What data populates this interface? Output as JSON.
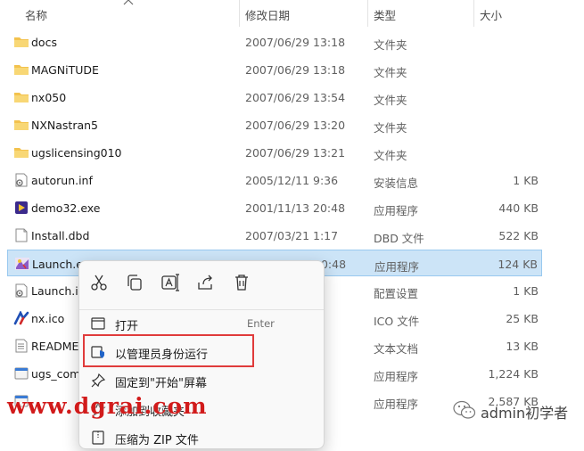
{
  "header": {
    "name": "名称",
    "date": "修改日期",
    "type": "类型",
    "size": "大小"
  },
  "files": [
    {
      "name": "docs",
      "date": "2007/06/29 13:18",
      "type": "文件夹",
      "size": "",
      "icon": "folder-icon"
    },
    {
      "name": "MAGNiTUDE",
      "date": "2007/06/29 13:18",
      "type": "文件夹",
      "size": "",
      "icon": "folder-icon"
    },
    {
      "name": "nx050",
      "date": "2007/06/29 13:54",
      "type": "文件夹",
      "size": "",
      "icon": "folder-icon"
    },
    {
      "name": "NXNastran5",
      "date": "2007/06/29 13:20",
      "type": "文件夹",
      "size": "",
      "icon": "folder-icon"
    },
    {
      "name": "ugslicensing010",
      "date": "2007/06/29 13:21",
      "type": "文件夹",
      "size": "",
      "icon": "folder-icon"
    },
    {
      "name": "autorun.inf",
      "date": "2005/12/11 9:36",
      "type": "安装信息",
      "size": "1 KB",
      "icon": "setup-info-icon"
    },
    {
      "name": "demo32.exe",
      "date": "2001/11/13 20:48",
      "type": "应用程序",
      "size": "440 KB",
      "icon": "media-app-icon"
    },
    {
      "name": "Install.dbd",
      "date": "2007/03/21 1:17",
      "type": "DBD 文件",
      "size": "522 KB",
      "icon": "document-icon"
    },
    {
      "name": "Launch.exe",
      "date": "2001/11/13 20:48",
      "type": "应用程序",
      "size": "124 KB",
      "icon": "launch-app-icon",
      "selected": true
    },
    {
      "name": "Launch.ini",
      "date": "7",
      "type": "配置设置",
      "size": "1 KB",
      "icon": "settings-file-icon"
    },
    {
      "name": "nx.ico",
      "date": "6",
      "type": "ICO 文件",
      "size": "25 KB",
      "icon": "nx-logo-icon"
    },
    {
      "name": "README",
      "date": "20",
      "type": "文本文档",
      "size": "13 KB",
      "icon": "text-file-icon"
    },
    {
      "name": "ugs_com",
      "date": "2",
      "type": "应用程序",
      "size": "1,224 KB",
      "icon": "app-icon"
    },
    {
      "name": "",
      "date": "34",
      "type": "应用程序",
      "size": "2,587 KB",
      "icon": "app-icon"
    }
  ],
  "context_menu": {
    "toolbar": [
      "cut-icon",
      "copy-icon",
      "rename-icon",
      "share-icon",
      "delete-icon"
    ],
    "items": [
      {
        "label": "打开",
        "shortcut": "Enter",
        "icon": "open-icon"
      },
      {
        "label": "以管理员身份运行",
        "shortcut": "",
        "icon": "shield-icon"
      },
      {
        "label": "固定到\"开始\"屏幕",
        "shortcut": "",
        "icon": "pin-icon"
      },
      {
        "label": "添加到收藏夹",
        "shortcut": "",
        "icon": "star-icon"
      },
      {
        "label": "压缩为 ZIP 文件",
        "shortcut": "",
        "icon": "zip-icon"
      }
    ]
  },
  "watermarks": {
    "left": "www.dgrai.com",
    "right": "admin初学者"
  },
  "colors": {
    "selection": "#cce4f7",
    "highlight_border": "#e03b3b",
    "watermark_red": "#d11b1b",
    "folder": "#f3c24d"
  }
}
